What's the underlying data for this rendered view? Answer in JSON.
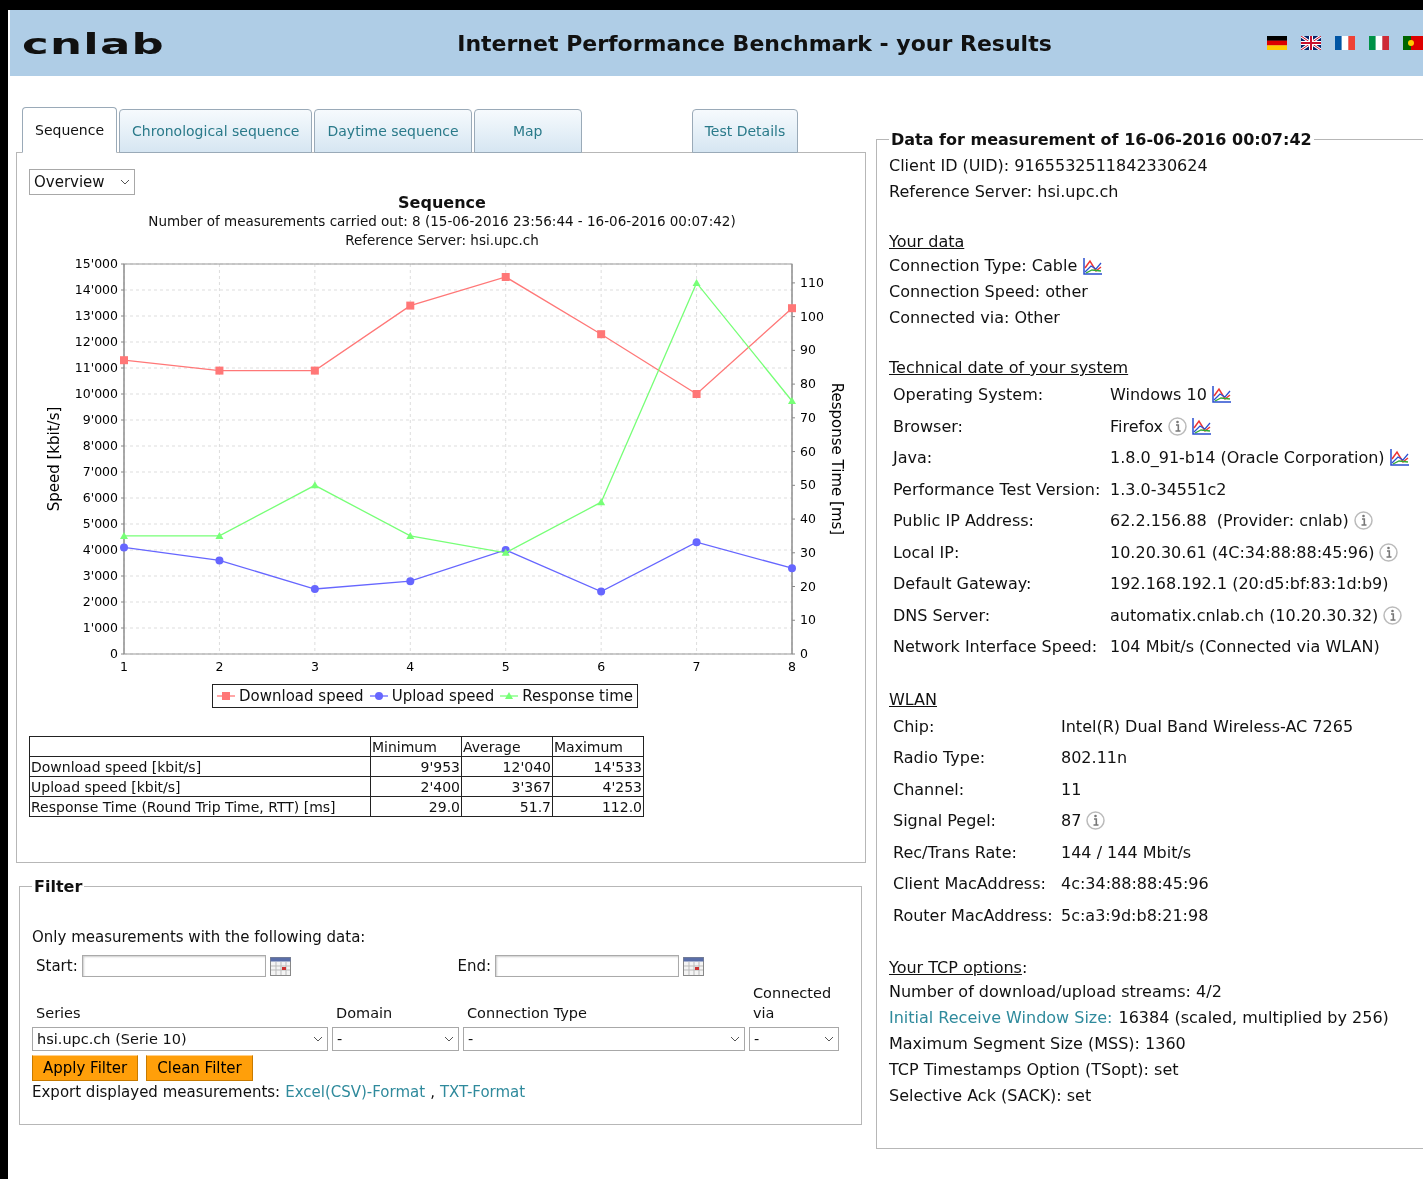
{
  "header": {
    "logo": "cnlab",
    "title": "Internet Performance Benchmark - your Results"
  },
  "tabs": [
    {
      "label": "Sequence",
      "selected": true
    },
    {
      "label": "Chronological sequence",
      "selected": false
    },
    {
      "label": "Daytime sequence",
      "selected": false
    },
    {
      "label": "Map",
      "selected": false
    }
  ],
  "side_tabs": [
    {
      "label": "Test Details",
      "selected": false
    }
  ],
  "view_select": {
    "value": "Overview"
  },
  "chart": {
    "title": "Sequence",
    "subtitle": "Number of measurements carried out: 8 (15-06-2016 23:56:44 - 16-06-2016 00:07:42)",
    "server": "Reference Server: hsi.upc.ch",
    "chart_data": {
      "type": "line",
      "ylabel": "Speed [kbit/s]",
      "y2label": "Response Time [ms]",
      "x": [
        "1",
        "2",
        "3",
        "4",
        "5",
        "6",
        "7",
        "8"
      ],
      "ylim": [
        0,
        15000
      ],
      "grid": true,
      "legend": "bottom",
      "y2lim": [
        0,
        115.6
      ],
      "yticks": [
        {
          "value": 0,
          "label": "0"
        },
        {
          "value": 1000,
          "label": "1'000"
        },
        {
          "value": 2000,
          "label": "2'000"
        },
        {
          "value": 3000,
          "label": "3'000"
        },
        {
          "value": 4000,
          "label": "4'000"
        },
        {
          "value": 5000,
          "label": "5'000"
        },
        {
          "value": 6000,
          "label": "6'000"
        },
        {
          "value": 7000,
          "label": "7'000"
        },
        {
          "value": 8000,
          "label": "8'000"
        },
        {
          "value": 9000,
          "label": "9'000"
        },
        {
          "value": 10000,
          "label": "10'000"
        },
        {
          "value": 11000,
          "label": "11'000"
        },
        {
          "value": 12000,
          "label": "12'000"
        },
        {
          "value": 13000,
          "label": "13'000"
        },
        {
          "value": 14000,
          "label": "14'000"
        },
        {
          "value": 15000,
          "label": "15'000"
        }
      ],
      "y2ticks": [
        0,
        10,
        20,
        30,
        40,
        50,
        60,
        70,
        80,
        90,
        100,
        110
      ],
      "series": [
        {
          "name": "Download speed",
          "color": "#ff7777",
          "marker": "square",
          "values": [
            11300,
            10900,
            10900,
            13400,
            14500,
            12300,
            10000,
            13300
          ]
        },
        {
          "name": "Upload speed",
          "color": "#6666ff",
          "marker": "circle",
          "values": [
            4100,
            3600,
            2500,
            2800,
            4000,
            2400,
            4300,
            3300
          ]
        },
        {
          "name": "Response time",
          "color": "#77ff77",
          "axis": "y2",
          "marker": "triangle",
          "values": [
            35,
            35,
            50,
            35,
            30,
            45,
            110,
            75
          ]
        }
      ]
    }
  },
  "stats_table": {
    "columns": [
      "Minimum",
      "Average",
      "Maximum"
    ],
    "rows": [
      {
        "label": "Download speed [kbit/s]",
        "values": [
          "9'953",
          "12'040",
          "14'533"
        ]
      },
      {
        "label": "Upload speed [kbit/s]",
        "values": [
          "2'400",
          "3'367",
          "4'253"
        ]
      },
      {
        "label": "Response Time (Round Trip Time, RTT) [ms]",
        "values": [
          "29.0",
          "51.7",
          "112.0"
        ]
      }
    ]
  },
  "filter": {
    "title": "Filter",
    "intro": "Only measurements with the following data:",
    "start": "Start:",
    "end": "End:",
    "selects": [
      {
        "label": "Series",
        "value": "hsi.upc.ch (Serie 10)"
      },
      {
        "label": "Domain",
        "value": "-"
      },
      {
        "label": "Connection Type",
        "value": "-"
      },
      {
        "label": "Connected via",
        "value": "-"
      }
    ],
    "buttons": [
      "Apply Filter",
      "Clean Filter"
    ],
    "export_label": "Export displayed measurements:",
    "export_links": [
      "Excel(CSV)-Format",
      "TXT-Format"
    ],
    "export_separator": ","
  },
  "details": {
    "title": "Data for measurement of 16-06-2016 00:07:42",
    "sections": [
      {
        "kind": "lines",
        "items": [
          {
            "text": "Client ID (UID): 9165532511842330624"
          },
          {
            "text": "Reference Server: hsi.upc.ch"
          }
        ]
      },
      {
        "kind": "lines",
        "heading": "Your data",
        "items": [
          {
            "text": "Connection Type: Cable",
            "chart": true
          },
          {
            "text": "Connection Speed: other"
          },
          {
            "text": "Connected via: Other"
          }
        ]
      },
      {
        "kind": "table",
        "heading": "Technical date of your system",
        "rows": [
          {
            "label": "Operating System:",
            "value": "Windows 10",
            "chart": true
          },
          {
            "label": "Browser:",
            "value": "Firefox",
            "info": true,
            "chart": true
          },
          {
            "label": "Java:",
            "value": "1.8.0_91-b14 (Oracle Corporation)",
            "chart": true
          },
          {
            "label": "Performance Test Version:",
            "value": "1.3.0-34551c2"
          },
          {
            "label": "Public IP Address:",
            "value": "62.2.156.88  (Provider: cnlab)",
            "info": true
          },
          {
            "label": "Local IP:",
            "value": "10.20.30.61 (4C:34:88:88:45:96)",
            "info": true
          },
          {
            "label": "Default Gateway:",
            "value": "192.168.192.1 (20:d5:bf:83:1d:b9)"
          },
          {
            "label": "DNS Server:",
            "value": "automatix.cnlab.ch (10.20.30.32)",
            "info": true
          },
          {
            "label": "Network Interface Speed:",
            "value": "104 Mbit/s (Connected via WLAN)"
          }
        ]
      },
      {
        "kind": "table",
        "heading": "WLAN",
        "rows": [
          {
            "label": "Chip:",
            "value": "Intel(R) Dual Band Wireless-AC 7265"
          },
          {
            "label": "Radio Type:",
            "value": "802.11n"
          },
          {
            "label": "Channel:",
            "value": "11"
          },
          {
            "label": "Signal Pegel:",
            "value": "87",
            "info": true
          },
          {
            "label": "Rec/Trans Rate:",
            "value": "144 / 144 Mbit/s"
          },
          {
            "label": "Client MacAddress:",
            "value": "4c:34:88:88:45:96"
          },
          {
            "label": "Router MacAddress:",
            "value": "5c:a3:9d:b8:21:98"
          }
        ]
      },
      {
        "kind": "lines",
        "heading": "Your TCP options",
        "heading_suffix": ":",
        "items": [
          {
            "text": "Number of download/upload streams: 4/2"
          },
          {
            "link": "Initial Receive Window Size:",
            "text": "16384 (scaled, multiplied by 256)"
          },
          {
            "text": "Maximum Segment Size (MSS): 1360"
          },
          {
            "text": "TCP Timestamps Option (TSopt): set"
          },
          {
            "text": "Selective Ack (SACK): set"
          }
        ]
      }
    ]
  }
}
